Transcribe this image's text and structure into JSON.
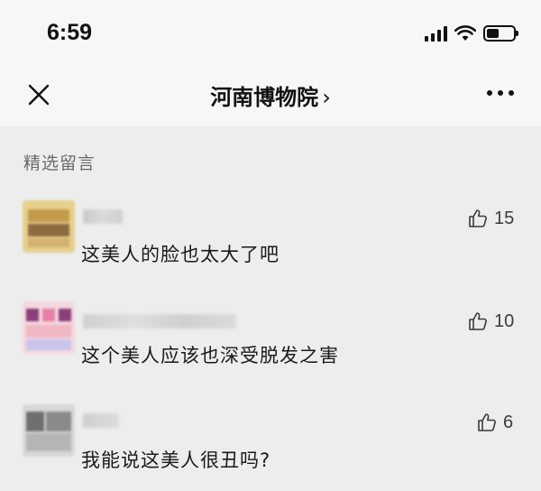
{
  "status_bar": {
    "time": "6:59"
  },
  "nav": {
    "title": "河南博物院",
    "chevron": "›",
    "close_icon": "close-icon",
    "more_icon": "more-icon"
  },
  "section": {
    "label": "精选留言"
  },
  "comments": [
    {
      "text": "这美人的脸也太大了吧",
      "likes": "15"
    },
    {
      "text": "这个美人应该也深受脱发之害",
      "likes": "10"
    },
    {
      "text": "我能说这美人很丑吗?",
      "likes": "6"
    }
  ],
  "colors": {
    "background": "#ededed",
    "header": "#f7f7f7",
    "text": "#1a1a1a",
    "muted": "#6a6a6a"
  }
}
